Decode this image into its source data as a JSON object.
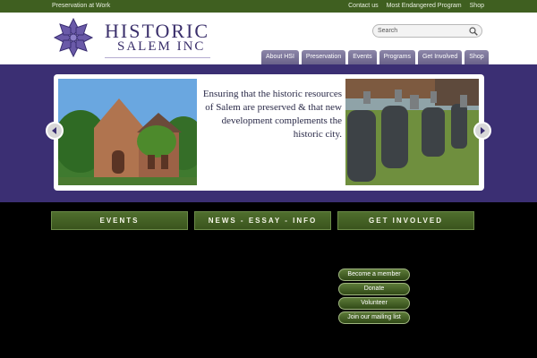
{
  "topbar": {
    "left": "Preservation at Work",
    "links": [
      "Contact us",
      "Most Endangered Program",
      "Shop"
    ]
  },
  "logo": {
    "line1": "HISTORIC",
    "line2": "SALEM INC"
  },
  "search": {
    "placeholder": "Search"
  },
  "nav": [
    "About HSI",
    "Preservation",
    "Events",
    "Programs",
    "Get Involved",
    "Shop"
  ],
  "slider": {
    "text": "Ensuring that the historic resources of Salem are preserved & that new development complements the historic city."
  },
  "columns": {
    "events": "EVENTS",
    "news": "NEWS - ESSAY - INFO",
    "get_involved": "GET INVOLVED"
  },
  "actions": [
    "Become a member",
    "Donate",
    "Volunteer",
    "Join our mailing list"
  ],
  "colors": {
    "topbar": "#3f5f20",
    "band": "#3b2f73",
    "accent": "#5b3da6"
  }
}
